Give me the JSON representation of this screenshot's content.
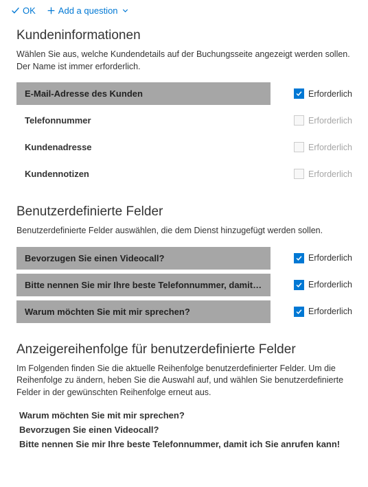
{
  "toolbar": {
    "ok_label": "OK",
    "add_label": "Add a question"
  },
  "s1": {
    "title": "Kundeninformationen",
    "desc": "Wählen Sie aus, welche Kundendetails auf der Buchungsseite angezeigt werden sollen. Der Name ist immer erforderlich.",
    "req": "Erforderlich",
    "items": [
      {
        "label": "E-Mail-Adresse des Kunden",
        "shaded": true,
        "checked": true,
        "disabled": false
      },
      {
        "label": "Telefonnummer",
        "shaded": false,
        "checked": false,
        "disabled": true
      },
      {
        "label": "Kundenadresse",
        "shaded": false,
        "checked": false,
        "disabled": true
      },
      {
        "label": "Kundennotizen",
        "shaded": false,
        "checked": false,
        "disabled": true
      }
    ]
  },
  "s2": {
    "title": "Benutzerdefinierte Felder",
    "desc": "Benutzerdefinierte Felder auswählen, die dem Dienst hinzugefügt werden sollen.",
    "req": "Erforderlich",
    "items": [
      {
        "label": "Bevorzugen Sie einen Videocall?",
        "shaded": true,
        "checked": true,
        "disabled": false
      },
      {
        "label": "Bitte nennen Sie mir Ihre beste Telefonnummer, damit ich Sie anruf…",
        "shaded": true,
        "checked": true,
        "disabled": false
      },
      {
        "label": "Warum möchten Sie mit mir sprechen?",
        "shaded": true,
        "checked": true,
        "disabled": false
      }
    ]
  },
  "s3": {
    "title": "Anzeigereihenfolge für benutzerdefinierte Felder",
    "desc": "Im Folgenden finden Sie die aktuelle Reihenfolge benutzerdefinierter Felder. Um die Reihenfolge zu ändern, heben Sie die Auswahl auf, und wählen Sie benutzerdefinierte Felder in der gewünschten Reihenfolge erneut aus.",
    "items": [
      "Warum möchten Sie mit mir sprechen?",
      "Bevorzugen Sie einen Videocall?",
      "Bitte nennen Sie mir Ihre beste Telefonnummer, damit ich Sie anrufen kann!"
    ]
  }
}
